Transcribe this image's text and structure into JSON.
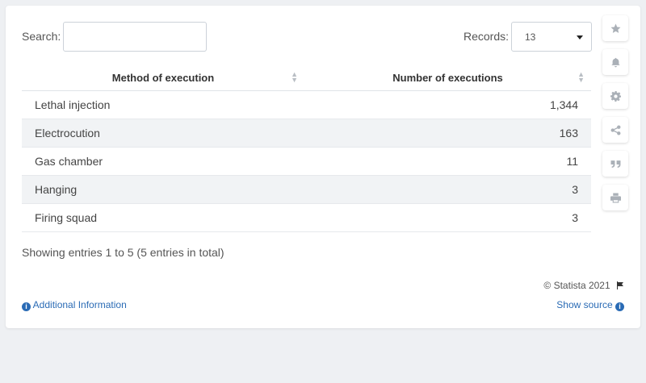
{
  "search": {
    "label": "Search:",
    "value": ""
  },
  "records": {
    "label": "Records:",
    "selected": "13"
  },
  "table": {
    "headers": [
      "Method of execution",
      "Number of executions"
    ],
    "rows": [
      {
        "method": "Lethal injection",
        "count": "1,344"
      },
      {
        "method": "Electrocution",
        "count": "163"
      },
      {
        "method": "Gas chamber",
        "count": "11"
      },
      {
        "method": "Hanging",
        "count": "3"
      },
      {
        "method": "Firing squad",
        "count": "3"
      }
    ]
  },
  "footer": {
    "showing": "Showing entries 1 to 5 (5 entries in total)",
    "copyright": "© Statista 2021",
    "additional_info": "Additional Information",
    "show_source": "Show source"
  },
  "toolbar": [
    "star-icon",
    "bell-icon",
    "gear-icon",
    "share-icon",
    "quote-icon",
    "print-icon"
  ],
  "colors": {
    "link": "#2a6bb5",
    "row_alt": "#f1f3f5",
    "icon": "#aab0b7"
  }
}
